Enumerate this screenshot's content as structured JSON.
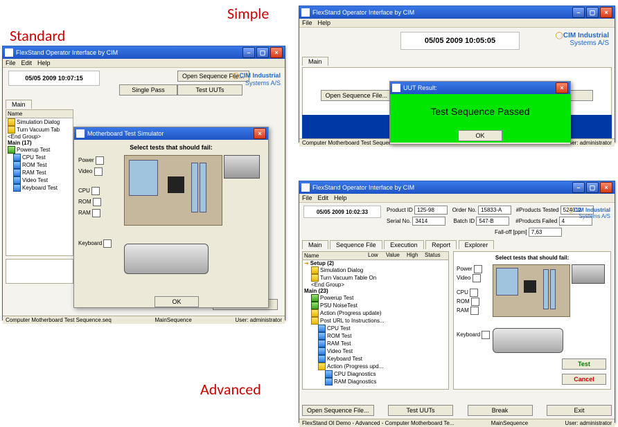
{
  "labels": {
    "simple": "Simple",
    "standard": "Standard",
    "advanced": "Advanced"
  },
  "common": {
    "app_title": "FlexStand Operator Interface by CIM",
    "menu": {
      "file": "File",
      "edit": "Edit",
      "help": "Help"
    },
    "logo_line1": "CIM Industrial",
    "logo_line2": "Systems A/S",
    "btn_open_seq": "Open Sequence File...",
    "btn_test_uuts": "Test UUTs",
    "btn_exit": "Exit",
    "btn_ok": "OK",
    "btn_cancel": "Cancel",
    "btn_test": "Test",
    "btn_break": "Break",
    "user_label": "User: administrator",
    "main_tab": "Main",
    "seq_mid": "MainSequence"
  },
  "simple_win": {
    "datetime": "05/05 2009  10:05:05",
    "status_left": "Computer Motherboard Test Sequen",
    "dialog_title": "UUT Result:",
    "dialog_msg": "Test Sequence Passed"
  },
  "standard_win": {
    "datetime": "05/05 2009  10:07:15",
    "btn_single_pass": "Single Pass",
    "status_left": "Computer Motherboard Test Sequence.seq",
    "tree_header": "Name",
    "tree": [
      "Simulation Dialog",
      "Turn Vacuum Tab",
      "<End Group>",
      "Main (17)",
      "Powerup Test",
      "CPU Test",
      "ROM Test",
      "RAM Test",
      "Video Test",
      "Keyboard Test"
    ],
    "simulator": {
      "title": "Motherboard Test Simulator",
      "heading": "Select tests that should fail:",
      "opts": {
        "power": "Power",
        "video": "Video",
        "cpu": "CPU",
        "rom": "ROM",
        "ram": "RAM",
        "keyboard": "Keyboard"
      }
    }
  },
  "advanced_win": {
    "datetime": "05/05 2009  10:02:33",
    "fields": {
      "product_id_lbl": "Product ID",
      "product_id": "125-98",
      "order_no_lbl": "Order No.",
      "order_no": "15833-A",
      "products_tested_lbl": "#Products Tested",
      "products_tested": "524012",
      "serial_no_lbl": "Serial No.",
      "serial_no": "3414",
      "batch_id_lbl": "Batch ID",
      "batch_id": "547-B",
      "products_failed_lbl": "#Products Failed",
      "products_failed": "4",
      "falloff_lbl": "Fall-off [ppm]",
      "falloff": "7,63"
    },
    "tabs": [
      "Main",
      "Sequence File",
      "Execution",
      "Report",
      "Explorer"
    ],
    "cols": [
      "Name",
      "Low",
      "Value",
      "High",
      "Status"
    ],
    "tree": [
      "Setup (2)",
      "Simulation Dialog",
      "Turn Vacuum Table On",
      "<End Group>",
      "Main (23)",
      "Powerup Test",
      "PSU NoiseTest",
      "Action (Progress update)",
      "Post URL to Instructions...",
      "CPU Test",
      "ROM Test",
      "RAM Test",
      "Video Test",
      "Keyboard Test",
      "Action (Progress upd...",
      "CPU Diagnostics",
      "RAM Diagnostics"
    ],
    "sim_heading": "Select tests that should fail:",
    "sim_opts": {
      "power": "Power",
      "video": "Video",
      "cpu": "CPU",
      "rom": "ROM",
      "ram": "RAM",
      "keyboard": "Keyboard"
    },
    "status_left": "FlexStand OI Demo - Advanced - Computer Motherboard Te..."
  }
}
